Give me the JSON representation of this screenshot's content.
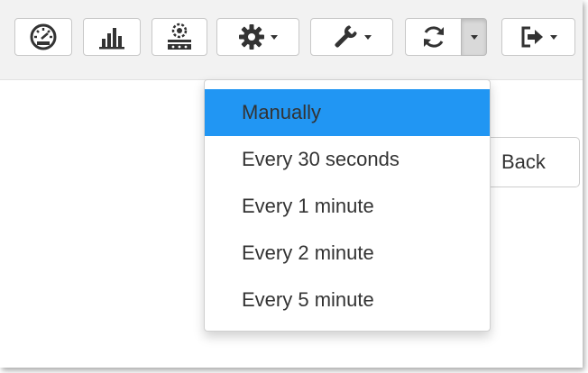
{
  "colors": {
    "toolbar_bg": "#f2f2f2",
    "accent": "#2196f3",
    "icon": "#333333",
    "border": "#c8c8c8"
  },
  "toolbar": {
    "buttons": [
      {
        "icon": "dashboard-icon",
        "has_caret": false
      },
      {
        "icon": "bar-chart-icon",
        "has_caret": false
      },
      {
        "icon": "server-settings-icon",
        "has_caret": false
      },
      {
        "icon": "gear-icon",
        "has_caret": true
      },
      {
        "icon": "wrench-icon",
        "has_caret": true
      },
      {
        "icon": "refresh-icon",
        "has_caret": false,
        "split_caret": true
      },
      {
        "icon": "sign-out-icon",
        "has_caret": true
      }
    ]
  },
  "refresh_menu": {
    "selected": "Manually",
    "items": [
      {
        "label": "Manually",
        "active": true
      },
      {
        "label": "Every 30 seconds",
        "active": false
      },
      {
        "label": "Every 1 minute",
        "active": false
      },
      {
        "label": "Every 2 minute",
        "active": false
      },
      {
        "label": "Every 5 minute",
        "active": false
      }
    ]
  },
  "page": {
    "back_label": "Back"
  }
}
